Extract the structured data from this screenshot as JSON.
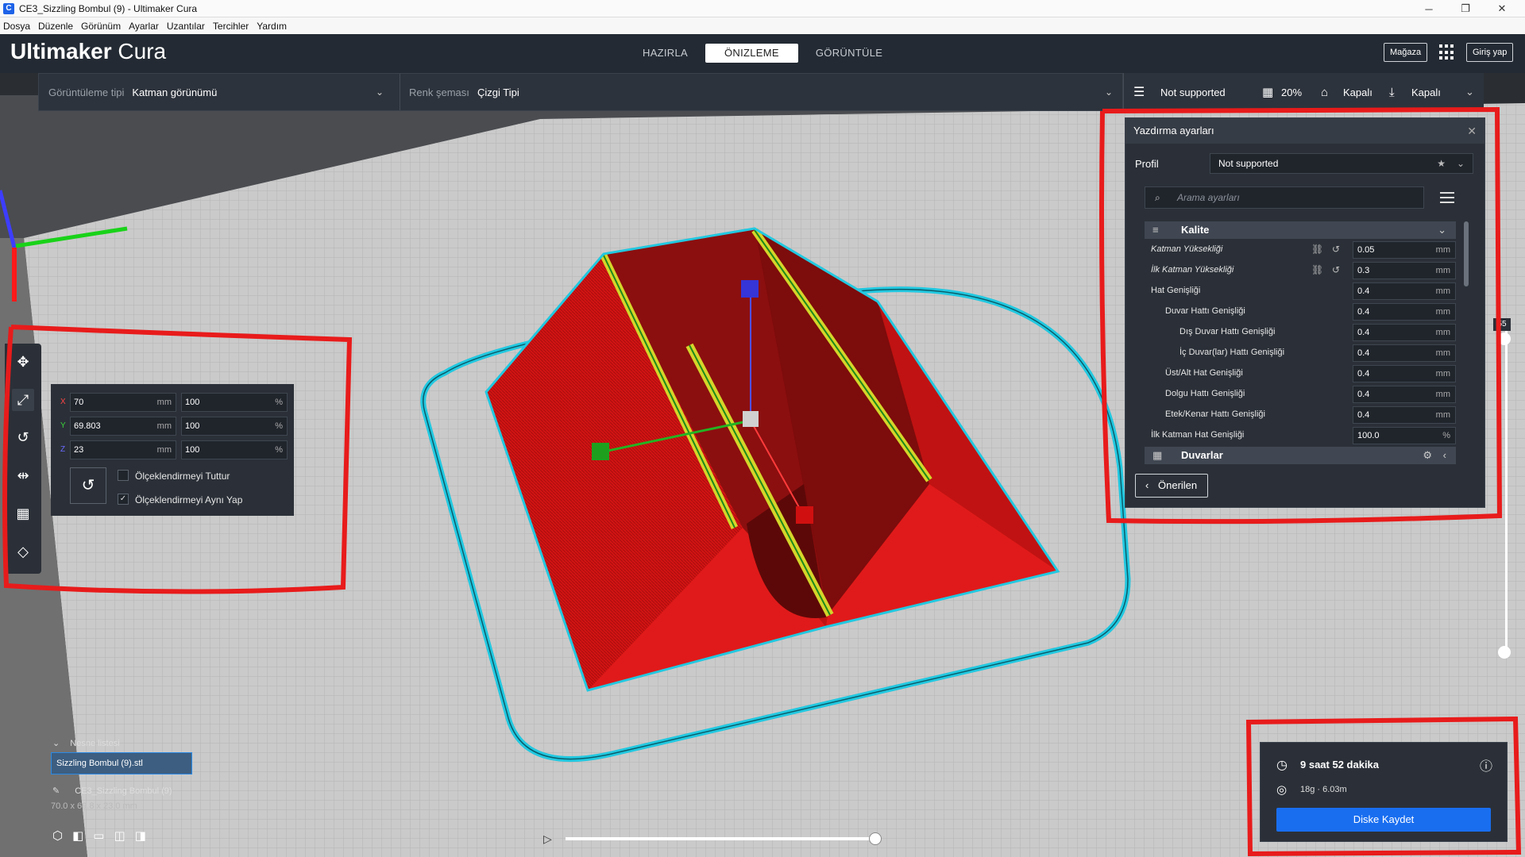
{
  "window": {
    "title": "CE3_Sizzling Bombul (9) - Ultimaker Cura",
    "minimize": "─",
    "maximize": "❐",
    "close": "✕"
  },
  "menu": [
    "Dosya",
    "Düzenle",
    "Görünüm",
    "Ayarlar",
    "Uzantılar",
    "Tercihler",
    "Yardım"
  ],
  "header": {
    "logo_bold": "Ultimaker",
    "logo_light": "Cura",
    "stages": [
      "HAZIRLA",
      "ÖNIZLEME",
      "GÖRÜNTÜLE"
    ],
    "active_stage": "ÖNIZLEME",
    "store": "Mağaza",
    "login": "Giriş yap"
  },
  "viewbar": {
    "view_type_label": "Görüntüleme tipi",
    "view_type_value": "Katman görünümü",
    "color_scheme_label": "Renk şeması",
    "color_scheme_value": "Çizgi Tipi"
  },
  "print_selector": {
    "profile": "Not supported",
    "infill": "20%",
    "support": "Kapalı",
    "adhesion": "Kapalı"
  },
  "print_settings": {
    "title": "Yazdırma ayarları",
    "profile_label": "Profil",
    "profile_value": "Not supported",
    "search_placeholder": "Arama ayarları",
    "category_quality": "Kalite",
    "category_walls": "Duvarlar",
    "rows": [
      {
        "label": "Katman Yüksekliği",
        "value": "0.05",
        "unit": "mm"
      },
      {
        "label": "İlk Katman Yüksekliği",
        "value": "0.3",
        "unit": "mm"
      },
      {
        "label": "Hat Genişliği",
        "value": "0.4",
        "unit": "mm"
      },
      {
        "label": "Duvar Hattı Genişliği",
        "value": "0.4",
        "unit": "mm"
      },
      {
        "label": "Dış Duvar Hattı Genişliği",
        "value": "0.4",
        "unit": "mm"
      },
      {
        "label": "İç Duvar(lar) Hattı Genişliği",
        "value": "0.4",
        "unit": "mm"
      },
      {
        "label": "Üst/Alt Hat Genişliği",
        "value": "0.4",
        "unit": "mm"
      },
      {
        "label": "Dolgu Hattı Genişliği",
        "value": "0.4",
        "unit": "mm"
      },
      {
        "label": "Etek/Kenar Hattı Genişliği",
        "value": "0.4",
        "unit": "mm"
      },
      {
        "label": "İlk Katman Hat Genişliği",
        "value": "100.0",
        "unit": "%"
      }
    ],
    "recommended_button": "Önerilen"
  },
  "scale_tool": {
    "x_mm": "70",
    "y_mm": "69.803",
    "z_mm": "23",
    "x_pct": "100",
    "y_pct": "100",
    "z_pct": "100",
    "unit_mm": "mm",
    "unit_pct": "%",
    "axis_x": "X",
    "axis_y": "Y",
    "axis_z": "Z",
    "snap_label": "Ölçeklendirmeyi Tuttur",
    "uniform_label": "Ölçeklendirmeyi Aynı Yap",
    "snap_checked": false,
    "uniform_checked": true
  },
  "object_list": {
    "title": "Nesne listesi",
    "file": "Sizzling Bombul (9).stl",
    "job_name": "CE3_Sizzling Bombul (9)",
    "dimensions": "70.0 x 69.8 x 23.0 mm"
  },
  "summary": {
    "time": "9 saat 52 dakika",
    "material": "18g · 6.03m",
    "save_button": "Diske Kaydet"
  },
  "layer_slider": {
    "top_value": "55"
  },
  "colors": {
    "accent": "#196ef0",
    "header": "#232a33",
    "panel": "#2b3038",
    "model": "#d91a1a",
    "travel": "#22c8e0",
    "annotation": "#e81b1b"
  }
}
